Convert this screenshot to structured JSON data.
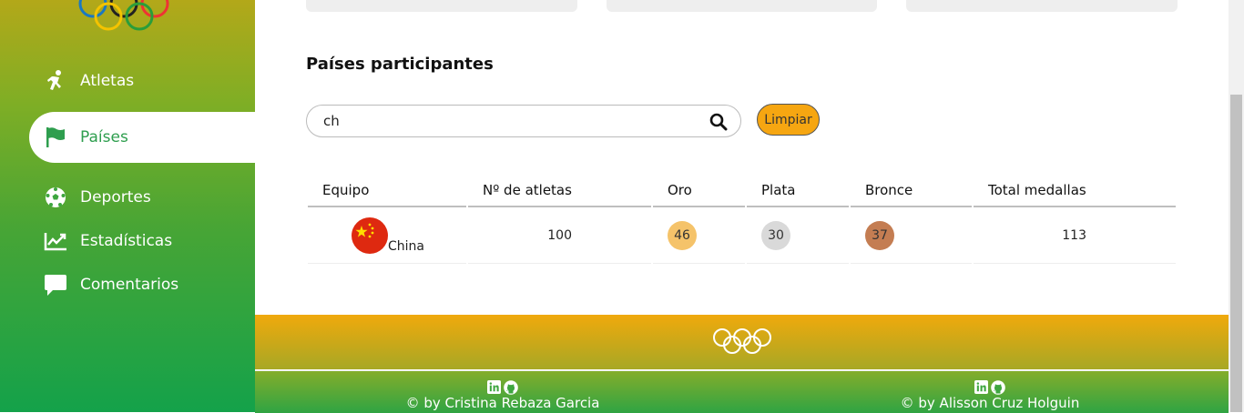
{
  "sidebar": {
    "items": [
      {
        "label": "Atletas",
        "icon": "running-person-icon"
      },
      {
        "label": "Países",
        "icon": "flag-icon",
        "active": true
      },
      {
        "label": "Deportes",
        "icon": "soccer-ball-icon"
      },
      {
        "label": "Estadísticas",
        "icon": "line-chart-icon"
      },
      {
        "label": "Comentarios",
        "icon": "comment-icon"
      }
    ]
  },
  "main": {
    "title": "Países participantes",
    "search": {
      "value": "ch",
      "placeholder": ""
    },
    "clear_label": "Limpiar"
  },
  "table": {
    "headers": [
      "Equipo",
      "Nº de atletas",
      "Oro",
      "Plata",
      "Bronce",
      "Total medallas"
    ],
    "rows": [
      {
        "team": "China",
        "athletes": "100",
        "gold": "46",
        "silver": "30",
        "bronze": "37",
        "total": "113"
      }
    ]
  },
  "footer": {
    "credits": [
      {
        "text": "© by Cristina Rebaza Garcia"
      },
      {
        "text": "© by Alisson Cruz Holguin"
      }
    ]
  },
  "colors": {
    "gold": "#f5c36a",
    "silver": "#d9d9d9",
    "bronze": "#c47d52",
    "accent": "#f6a611",
    "nav_active_text": "#2e9e4e"
  }
}
